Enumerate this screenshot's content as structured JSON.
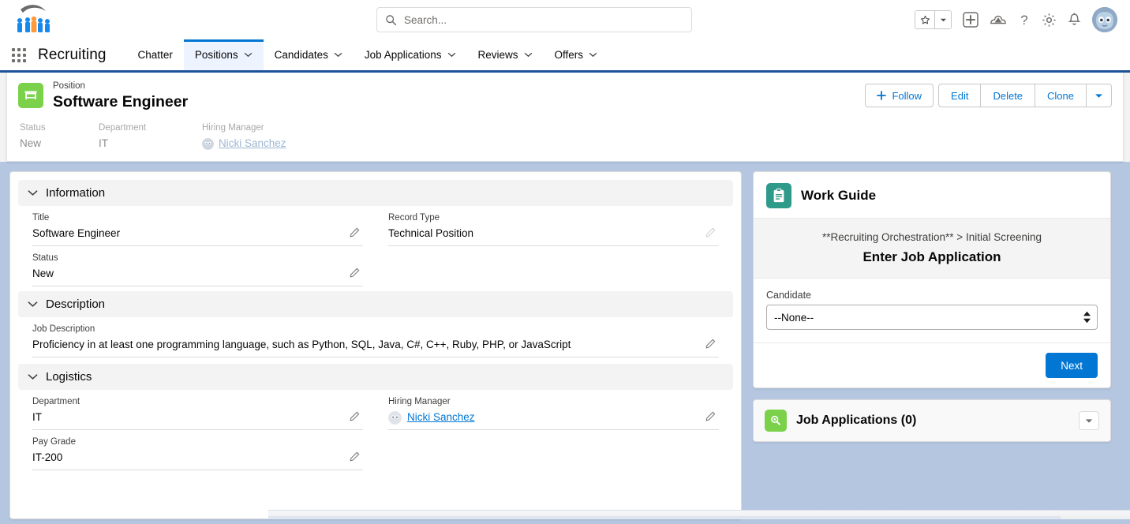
{
  "header": {
    "logo_alt": "company-logo",
    "search": {
      "placeholder": "Search...",
      "value": ""
    },
    "icons": [
      {
        "name": "favorites-star-icon",
        "glyph": "★"
      },
      {
        "name": "favorites-caret-icon",
        "glyph": "▾"
      },
      {
        "name": "add-plus-icon",
        "glyph": "+"
      },
      {
        "name": "app-launcher-cloud-icon",
        "glyph": "☁"
      },
      {
        "name": "help-question-icon",
        "glyph": "?"
      },
      {
        "name": "setup-gear-icon",
        "glyph": "⚙"
      },
      {
        "name": "notifications-bell-icon",
        "glyph": "🔔"
      },
      {
        "name": "user-avatar",
        "glyph": ""
      }
    ]
  },
  "appnav": {
    "app_name": "Recruiting",
    "items": [
      {
        "label": "Chatter",
        "has_caret": false,
        "active": false
      },
      {
        "label": "Positions",
        "has_caret": true,
        "active": true
      },
      {
        "label": "Candidates",
        "has_caret": true,
        "active": false
      },
      {
        "label": "Job Applications",
        "has_caret": true,
        "active": false
      },
      {
        "label": "Reviews",
        "has_caret": true,
        "active": false
      },
      {
        "label": "Offers",
        "has_caret": true,
        "active": false
      }
    ]
  },
  "record_header": {
    "object_label": "Position",
    "record_title": "Software Engineer",
    "icon_color": "#7bd14a",
    "actions": {
      "follow": "Follow",
      "edit": "Edit",
      "delete": "Delete",
      "clone": "Clone",
      "more": "▾"
    },
    "fields": [
      {
        "label": "Status",
        "value": "New",
        "is_link": false
      },
      {
        "label": "Department",
        "value": "IT",
        "is_link": false
      },
      {
        "label": "Hiring Manager",
        "value": "Nicki Sanchez",
        "is_link": true
      }
    ]
  },
  "details": {
    "sections": [
      {
        "title": "Information",
        "left": [
          {
            "label": "Title",
            "value": "Software Engineer",
            "editable": true
          },
          {
            "label": "Status",
            "value": "New",
            "editable": true
          }
        ],
        "right": [
          {
            "label": "Record Type",
            "value": "Technical Position",
            "editable": false
          }
        ]
      },
      {
        "title": "Description",
        "full": [
          {
            "label": "Job Description",
            "value": "Proficiency in at least one programming language, such as Python, SQL, Java, C#, C++, Ruby, PHP, or JavaScript",
            "editable": true
          }
        ]
      },
      {
        "title": "Logistics",
        "left": [
          {
            "label": "Department",
            "value": "IT",
            "editable": true
          },
          {
            "label": "Pay Grade",
            "value": "IT-200",
            "editable": true
          }
        ],
        "right": [
          {
            "label": "Hiring Manager",
            "value": "Nicki Sanchez",
            "editable": true,
            "is_link": true
          }
        ]
      }
    ]
  },
  "work_guide": {
    "title": "Work Guide",
    "icon_color": "#2e9a8a",
    "breadcrumb": "**Recruiting Orchestration** > Initial Screening",
    "stage_title": "Enter Job Application",
    "field_label": "Candidate",
    "field_value": "--None--",
    "field_options": [
      "--None--"
    ],
    "next_label": "Next"
  },
  "related_list": {
    "title": "Job Applications (0)",
    "icon_color": "#7bd14a",
    "menu_glyph": "▾"
  },
  "colors": {
    "brand_blue": "#0176d3",
    "nav_underline": "#1b5297",
    "page_background": "#b4c6e0",
    "active_tab_bg": "#eef4ff"
  }
}
